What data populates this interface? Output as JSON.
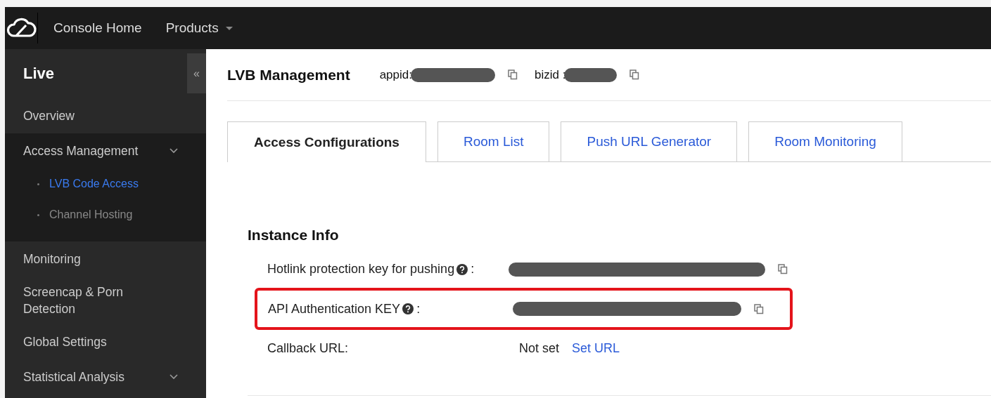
{
  "topbar": {
    "nav": [
      {
        "label": "Console Home",
        "has_menu": false
      },
      {
        "label": "Products",
        "has_menu": true
      }
    ]
  },
  "sidebar": {
    "title": "Live",
    "collapse_glyph": "«",
    "items": [
      {
        "kind": "link",
        "label": "Overview"
      },
      {
        "kind": "group",
        "label": "Access Management",
        "children": [
          {
            "label": "LVB Code Access",
            "selected": true
          },
          {
            "label": "Channel Hosting",
            "selected": false
          }
        ]
      },
      {
        "kind": "link",
        "label": "Monitoring"
      },
      {
        "kind": "link",
        "label": "Screencap & Porn Detection"
      },
      {
        "kind": "link",
        "label": "Global Settings"
      },
      {
        "kind": "group",
        "label": "Statistical Analysis"
      }
    ]
  },
  "header": {
    "title": "LVB Management",
    "ids": [
      {
        "label": "appid:",
        "redacted": true,
        "copyable": true
      },
      {
        "label": "bizid :",
        "redacted": true,
        "copyable": true
      }
    ]
  },
  "tabs": [
    {
      "label": "Access Configurations",
      "selected": true
    },
    {
      "label": "Room List",
      "selected": false
    },
    {
      "label": "Push URL Generator",
      "selected": false
    },
    {
      "label": "Room Monitoring",
      "selected": false
    }
  ],
  "section": {
    "title": "Instance Info",
    "rows": [
      {
        "kind": "secret",
        "label": "Hotlink protection key for pushing",
        "help": true,
        "separator": ":",
        "redacted": true,
        "copyable": true,
        "highlighted": false
      },
      {
        "kind": "secret",
        "label": "API Authentication KEY",
        "help": true,
        "separator": ":",
        "redacted": true,
        "copyable": true,
        "highlighted": true
      },
      {
        "kind": "setting",
        "label": "Callback URL",
        "help": false,
        "separator": ":",
        "value": "Not set",
        "action": "Set URL",
        "highlighted": false
      }
    ]
  }
}
